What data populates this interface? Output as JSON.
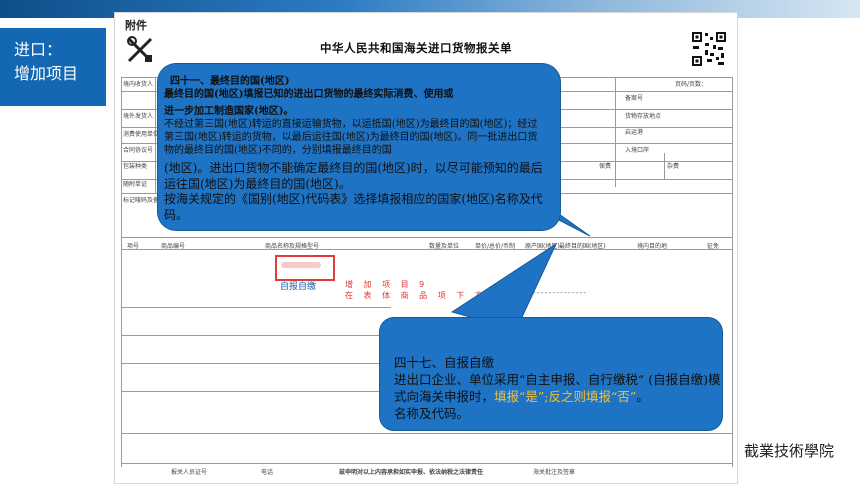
{
  "sidebar": {
    "line1": "进口：",
    "line2": "增加项目"
  },
  "form": {
    "attach_label": "附件",
    "title": "中华人民共和国海关进口货物报关单",
    "copy_label": "页码/页数：",
    "row_labels": [
      "境内收货人",
      "境外发货人",
      "消费使用单位",
      "合同协议号",
      "包装种类",
      "随附单证",
      "标记唛码及备注"
    ],
    "right_labels": [
      "备案号",
      "货物存放地点",
      "启运港",
      "入境口岸",
      "保费",
      "杂费"
    ],
    "item_headers": [
      "项号",
      "商品编号",
      "商品名称及规格型号",
      "数量及单位",
      "单价/总价/币制",
      "原产国(地区)",
      "最终目的国(地区)",
      "境内目的地",
      "征免"
    ],
    "self_pay_label": "自报自缴",
    "note_line1": "增 加 项 目 9",
    "note_line2": "在 表 体 商 品 项 下 方 打 印",
    "dashes": "…---------------",
    "footer_labels": [
      "报关人员",
      "报关人员证号",
      "电话",
      "兹申明对以上内容承担如实申报、依法纳税之法律责任",
      "海关批注及签章"
    ]
  },
  "bubble1": {
    "heading": "四十一、最终目的国(地区)",
    "bold_line1": "最终目的国(地区)填报已知的进出口货物的最终实际消费、使用或",
    "bold_line2": "进一步加工制造国家(地区)。",
    "text1": "不经过第三国(地区)转运的直接运输货物，以运抵国(地区)为最终目的国(地区)；经过第三国(地区)转运的货物，以最后运往国(地区)为最终目的国(地区)。同一批进出口货物的最终目的国(地区)不同的，分别填报最终目的国",
    "text2": "(地区)。进出口货物不能确定最终目的国(地区)时，以尽可能预知的最后运往国(地区)为最终目的国(地区)。",
    "text3": "按海关规定的《国别(地区)代码表》选择填报相应的国家(地区)名称及代码。"
  },
  "bubble2": {
    "heading": "四十七、自报自缴",
    "text_before": "进出口企业、单位采用“自主申报、自行缴税“ (自报自缴)模式向海关申报时，",
    "highlight": "填报“是”;反之则填报“否”",
    "text_after": "。",
    "tail": "名称及代码。"
  },
  "footer": {
    "school": "截業技術學院"
  },
  "colors": {
    "accent": "#1467b3",
    "bubble": "#1e73c4",
    "highlight": "#f1c232",
    "red": "#e23b3b"
  }
}
